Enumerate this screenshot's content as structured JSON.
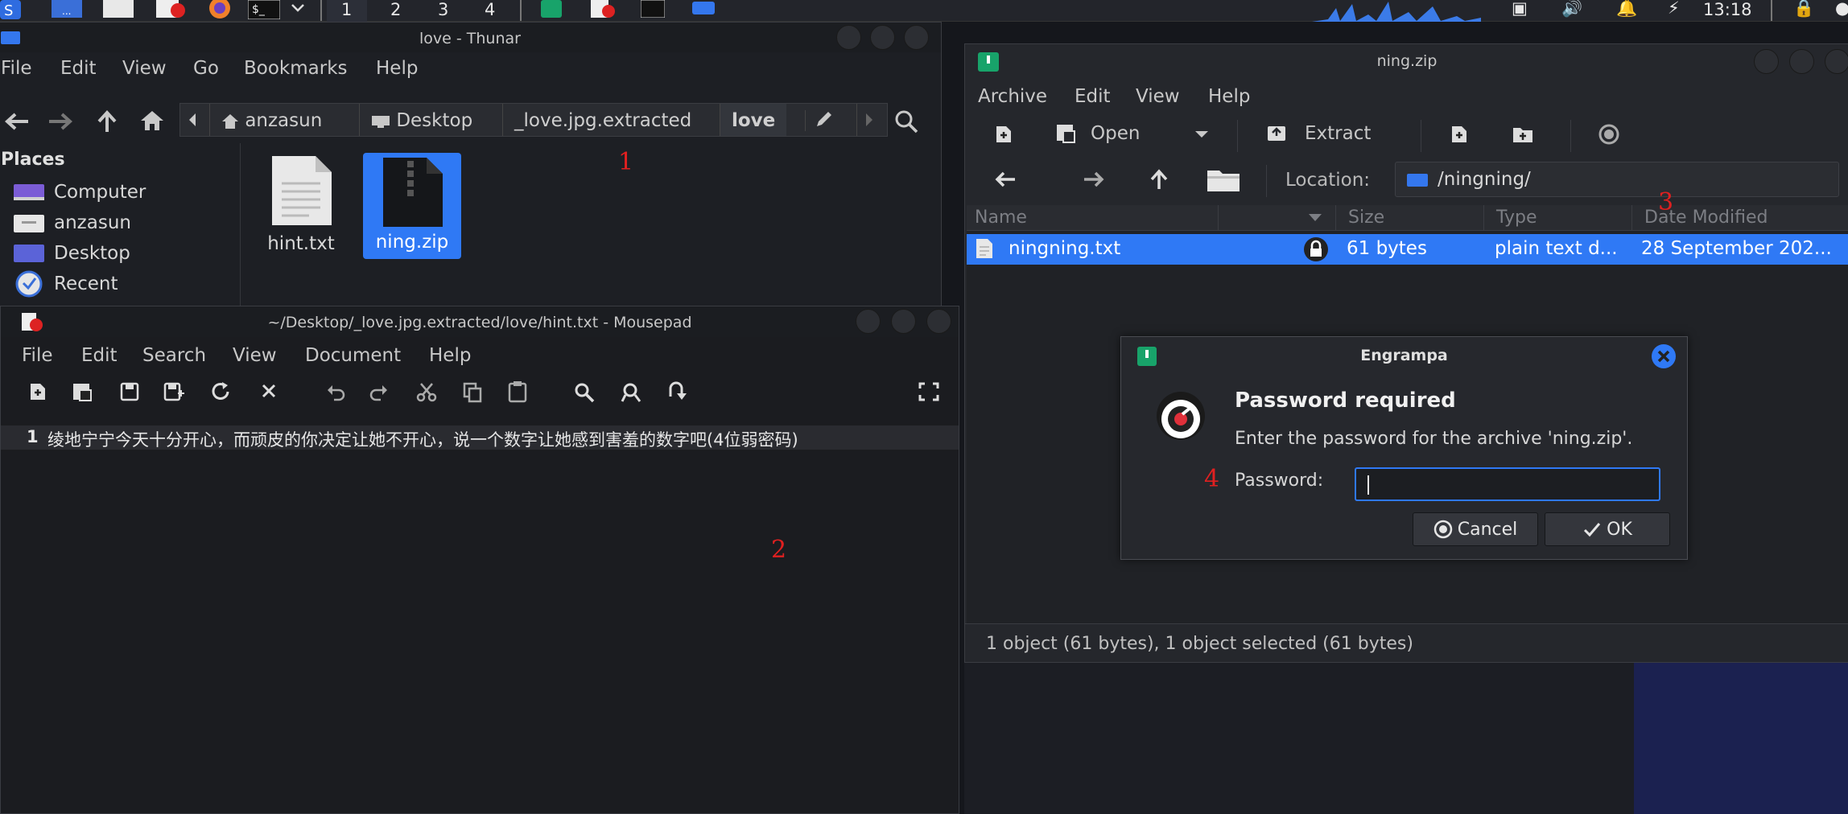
{
  "taskbar": {
    "workspaces": [
      "1",
      "2",
      "3",
      "4"
    ],
    "clock": "13:18"
  },
  "thunar": {
    "title": "love - Thunar",
    "menu": [
      "File",
      "Edit",
      "View",
      "Go",
      "Bookmarks",
      "Help"
    ],
    "breadcrumbs": [
      "anzasun",
      "Desktop",
      "_love.jpg.extracted",
      "love"
    ],
    "places_heading": "Places",
    "places": [
      "Computer",
      "anzasun",
      "Desktop",
      "Recent"
    ],
    "files": [
      "hint.txt",
      "ning.zip"
    ]
  },
  "mousepad": {
    "title": "~/Desktop/_love.jpg.extracted/love/hint.txt - Mousepad",
    "menu": [
      "File",
      "Edit",
      "Search",
      "View",
      "Document",
      "Help"
    ],
    "line_number": "1",
    "line_text": "绫地宁宁今天十分开心，而顽皮的你决定让她不开心，说一个数字让她感到害羞的数字吧(4位弱密码)"
  },
  "engrampa": {
    "title": "ning.zip",
    "menu": [
      "Archive",
      "Edit",
      "View",
      "Help"
    ],
    "toolbar": {
      "open": "Open",
      "extract": "Extract"
    },
    "location_label": "Location:",
    "location_value": "/ningning/",
    "columns": [
      "Name",
      "Size",
      "Type",
      "Date Modified"
    ],
    "rows": [
      {
        "name": "ningning.txt",
        "size": "61 bytes",
        "type": "plain text d...",
        "date": "28 September 202..."
      }
    ],
    "status": "1 object (61 bytes), 1 object selected (61 bytes)"
  },
  "dialog": {
    "title": "Engrampa",
    "heading": "Password required",
    "message": "Enter the password for the archive 'ning.zip'.",
    "password_label": "Password:",
    "password_value": "",
    "cancel": "Cancel",
    "ok": "OK"
  },
  "annotations": [
    "1",
    "2",
    "3",
    "4"
  ]
}
